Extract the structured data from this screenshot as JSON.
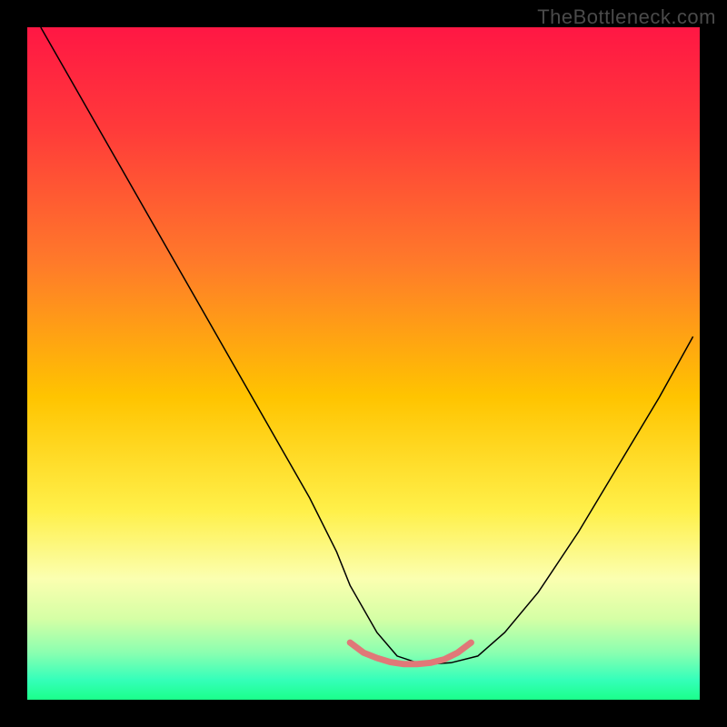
{
  "watermark": "TheBottleneck.com",
  "chart_data": {
    "type": "line",
    "title": "",
    "xlabel": "",
    "ylabel": "",
    "xlim": [
      0,
      100
    ],
    "ylim": [
      0,
      100
    ],
    "annotations": [],
    "background_gradient_stops": [
      {
        "offset": 0,
        "color": "#ff1744"
      },
      {
        "offset": 15,
        "color": "#ff3a3a"
      },
      {
        "offset": 35,
        "color": "#ff7a2a"
      },
      {
        "offset": 55,
        "color": "#ffc400"
      },
      {
        "offset": 72,
        "color": "#fff04a"
      },
      {
        "offset": 82,
        "color": "#fbffb0"
      },
      {
        "offset": 88,
        "color": "#d5ffa5"
      },
      {
        "offset": 93,
        "color": "#8affb0"
      },
      {
        "offset": 97,
        "color": "#35ffba"
      },
      {
        "offset": 100,
        "color": "#1bff8a"
      }
    ],
    "series": [
      {
        "name": "bottleneck-curve",
        "stroke": "#000000",
        "stroke_width": 1.5,
        "x": [
          2,
          6,
          10,
          14,
          18,
          22,
          26,
          30,
          34,
          38,
          42,
          46,
          48,
          52,
          55,
          58,
          60,
          63,
          67,
          71,
          76,
          82,
          88,
          94,
          99
        ],
        "y": [
          100,
          93,
          86,
          79,
          72,
          65,
          58,
          51,
          44,
          37,
          30,
          22,
          17,
          10,
          6.5,
          5.5,
          5.3,
          5.5,
          6.5,
          10,
          16,
          25,
          35,
          45,
          54
        ]
      },
      {
        "name": "bottom-highlight",
        "stroke": "#e07878",
        "stroke_width": 7,
        "x": [
          48,
          50,
          52,
          54,
          56,
          58,
          60,
          62,
          64,
          66
        ],
        "y": [
          8.5,
          7,
          6.2,
          5.6,
          5.3,
          5.3,
          5.5,
          6,
          7,
          8.5
        ]
      }
    ]
  }
}
